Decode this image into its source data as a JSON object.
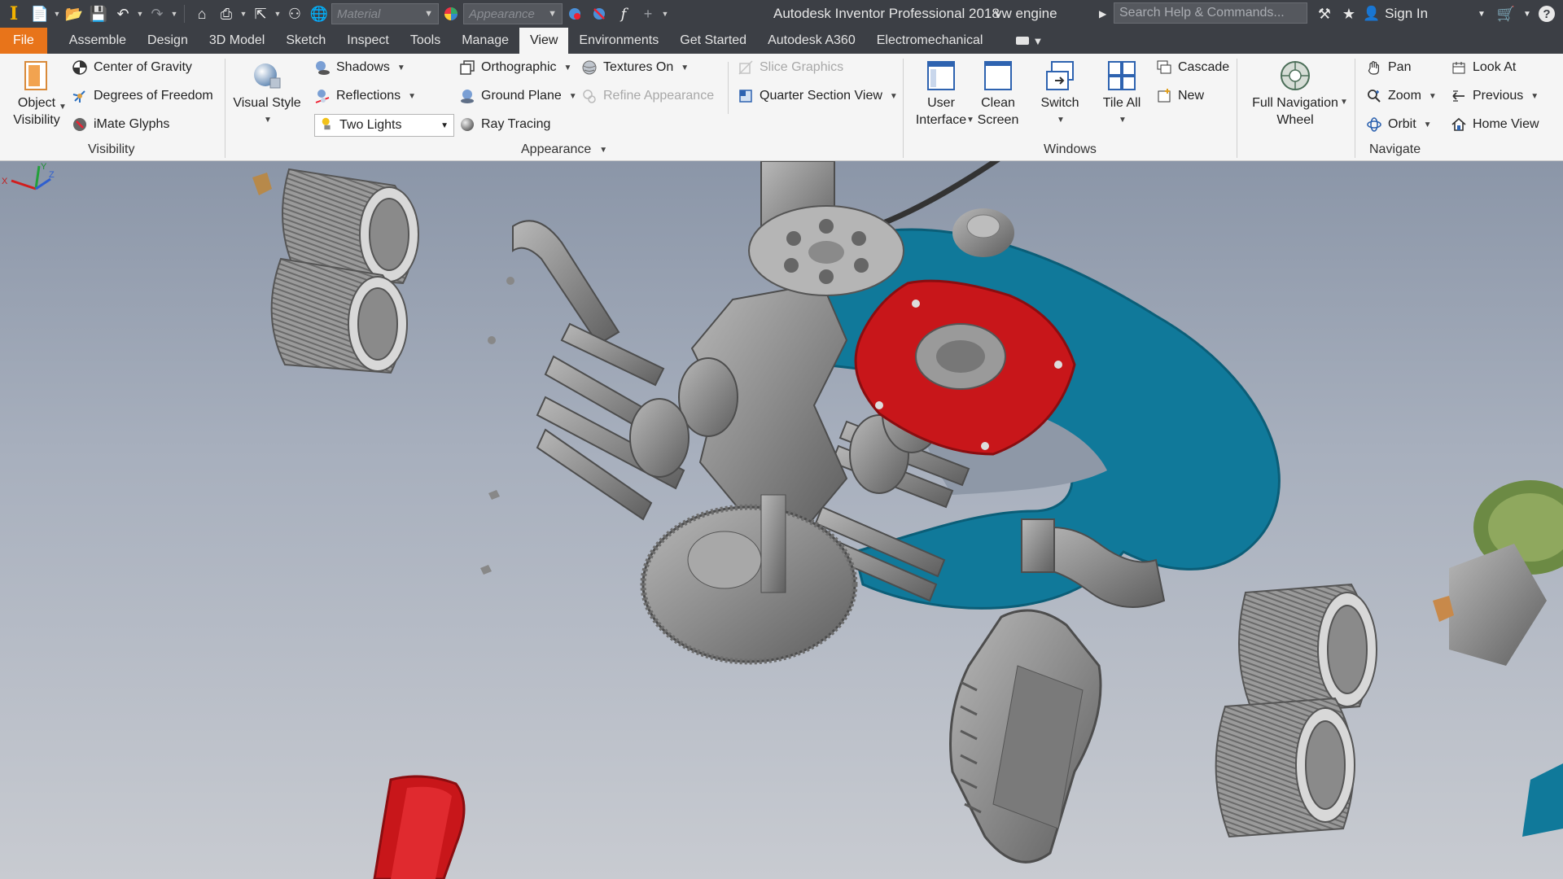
{
  "app": {
    "title": "Autodesk Inventor Professional 2018",
    "document": "vw engine"
  },
  "quick_access": {
    "material_placeholder": "Material",
    "appearance_placeholder": "Appearance",
    "search_placeholder": "Search Help & Commands...",
    "sign_in": "Sign In",
    "help": "?"
  },
  "tabs": [
    {
      "label": "File"
    },
    {
      "label": "Assemble"
    },
    {
      "label": "Design"
    },
    {
      "label": "3D Model"
    },
    {
      "label": "Sketch"
    },
    {
      "label": "Inspect"
    },
    {
      "label": "Tools"
    },
    {
      "label": "Manage"
    },
    {
      "label": "View",
      "active": true
    },
    {
      "label": "Environments"
    },
    {
      "label": "Get Started"
    },
    {
      "label": "Autodesk A360"
    },
    {
      "label": "Electromechanical"
    }
  ],
  "ribbon": {
    "visibility": {
      "panel_label": "Visibility",
      "object_visibility_line1": "Object",
      "object_visibility_line2": "Visibility",
      "center_of_gravity": "Center of Gravity",
      "degrees_of_freedom": "Degrees of Freedom",
      "imate_glyphs": "iMate Glyphs"
    },
    "appearance": {
      "panel_label": "Appearance",
      "visual_style": "Visual Style",
      "shadows": "Shadows",
      "reflections": "Reflections",
      "lighting_value": "Two Lights",
      "orthographic": "Orthographic",
      "ground_plane": "Ground Plane",
      "ray_tracing": "Ray Tracing",
      "textures_on": "Textures On",
      "refine_appearance": "Refine Appearance",
      "slice_graphics": "Slice Graphics",
      "quarter_section_view": "Quarter Section View"
    },
    "windows": {
      "panel_label": "Windows",
      "user_interface_line1": "User",
      "user_interface_line2": "Interface",
      "clean_screen_line1": "Clean",
      "clean_screen_line2": "Screen",
      "switch": "Switch",
      "tile_all": "Tile All",
      "cascade": "Cascade",
      "new": "New"
    },
    "navigate": {
      "panel_label": "Navigate",
      "full_nav_line1": "Full Navigation",
      "full_nav_line2": "Wheel",
      "pan": "Pan",
      "zoom": "Zoom",
      "orbit": "Orbit",
      "look_at": "Look At",
      "previous": "Previous",
      "home_view": "Home View"
    }
  },
  "viewport": {
    "triad_x": "X",
    "triad_y": "Y",
    "triad_z": "Z"
  },
  "colors": {
    "file_tab": "#e8741a",
    "titlebar": "#3c3f45",
    "engine_part": "#8e8e8e",
    "housing_blue": "#10799a",
    "cover_red": "#c8161a"
  }
}
